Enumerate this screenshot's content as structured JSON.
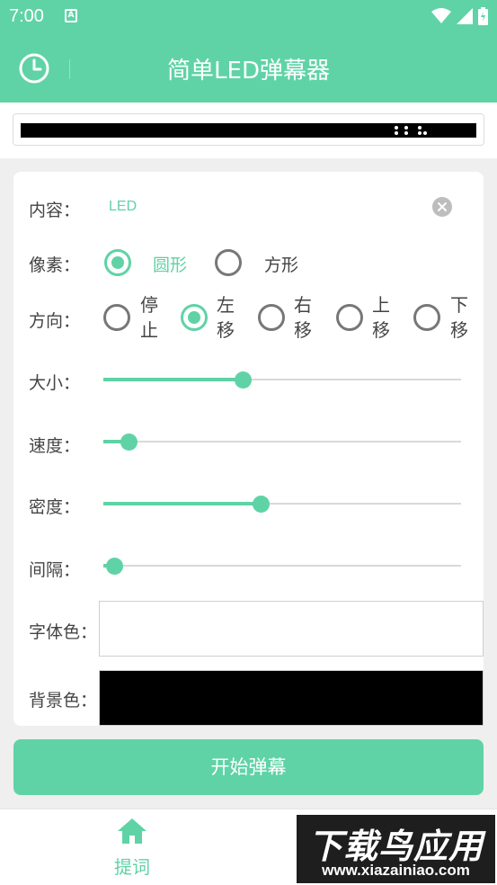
{
  "status_bar": {
    "time": "7:00",
    "notification_icon": "A"
  },
  "app_bar": {
    "title": "简单LED弹幕器",
    "history_icon": "clock-icon"
  },
  "form": {
    "content": {
      "label": "内容：",
      "value": "LED"
    },
    "pixel": {
      "label": "像素：",
      "options": [
        {
          "label": "圆形",
          "checked": true
        },
        {
          "label": "方形",
          "checked": false
        }
      ]
    },
    "direction": {
      "label": "方向：",
      "options": [
        {
          "label": "停止",
          "checked": false
        },
        {
          "label": "左移",
          "checked": true
        },
        {
          "label": "右移",
          "checked": false
        },
        {
          "label": "上移",
          "checked": false
        },
        {
          "label": "下移",
          "checked": false
        }
      ]
    },
    "size": {
      "label": "大小：",
      "value": 0.39
    },
    "speed": {
      "label": "速度：",
      "value": 0.07
    },
    "density": {
      "label": "密度：",
      "value": 0.44
    },
    "interval": {
      "label": "间隔：",
      "value": 0.03
    },
    "font_color": {
      "label": "字体色：",
      "value": "#ffffff"
    },
    "background_color": {
      "label": "背景色：",
      "value": "#000000"
    }
  },
  "start_button": {
    "label": "开始弹幕"
  },
  "bottom_nav": {
    "items": [
      {
        "label": "提词",
        "icon": "home-icon"
      }
    ]
  },
  "watermark": {
    "title": "下载鸟应用",
    "url": "www.xiazainiao.com"
  },
  "colors": {
    "accent": "#5fd3a6",
    "background": "#efefef"
  }
}
